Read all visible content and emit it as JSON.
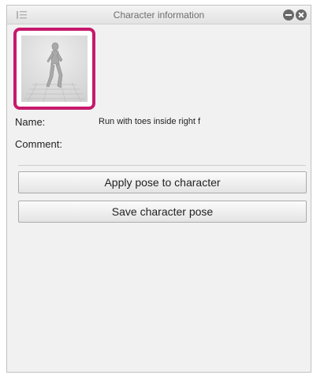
{
  "panel": {
    "title": "Character information",
    "icons": {
      "menu": "panel-menu-icon",
      "minimize": "minimize-icon",
      "close": "close-icon"
    }
  },
  "thumbnail": {
    "icon": "pose-figure-icon",
    "highlight_color": "#c7196d"
  },
  "info": {
    "name_label": "Name:",
    "name_value": "Run with toes inside right f",
    "comment_label": "Comment:",
    "comment_value": ""
  },
  "actions": {
    "apply_label": "Apply pose to character",
    "save_label": "Save character pose"
  }
}
